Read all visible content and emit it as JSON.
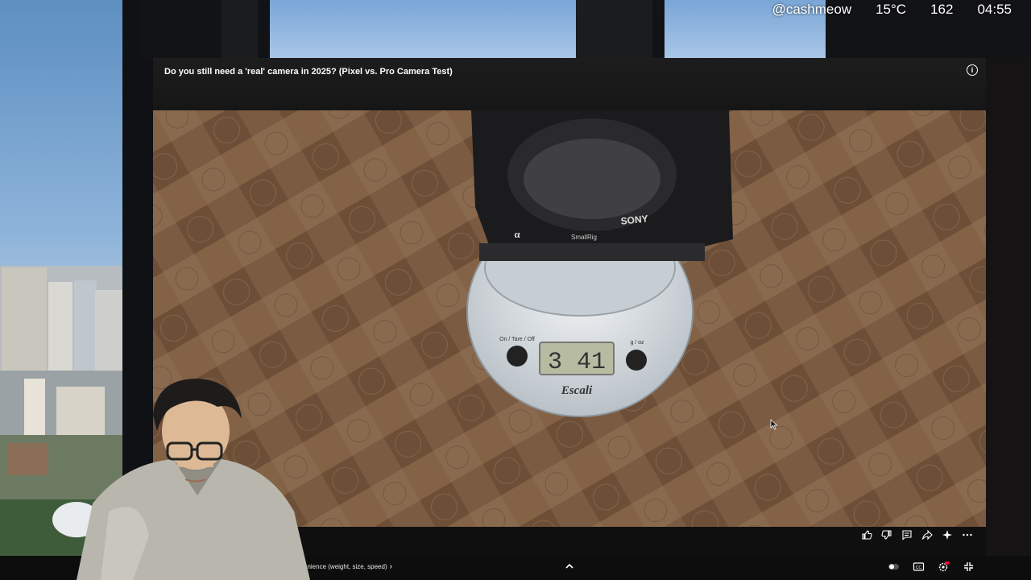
{
  "overlay": {
    "handle": "@cashmeow",
    "temperature": "15°C",
    "count": "162",
    "clock": "04:55"
  },
  "player": {
    "title": "Do you still need a 'real' camera in 2025? (Pixel vs. Pro Camera Test)",
    "info_icon": "i",
    "actions": [
      "like-icon",
      "dislike-icon",
      "comment-icon",
      "share-icon",
      "sparkle-icon",
      "more-icon"
    ]
  },
  "video_frame": {
    "scale_buttons_left": "On / Tare / Off",
    "scale_buttons_right": "g / oz",
    "scale_display": "3 41",
    "scale_brand": "Escali",
    "camera_brand": "SONY",
    "rig_brand": "SmallRig",
    "camera_mark": "α"
  },
  "controls": {
    "chapter": "venience (weight, size, speed)",
    "chapter_arrow": "›",
    "right_icons": [
      "autoplay-icon",
      "captions-icon",
      "settings-icon",
      "fullscreen-exit-icon"
    ]
  },
  "colors": {
    "accent_red": "#ff0033",
    "player_bg": "#0f0f0f",
    "wood": "#7a5a40"
  }
}
